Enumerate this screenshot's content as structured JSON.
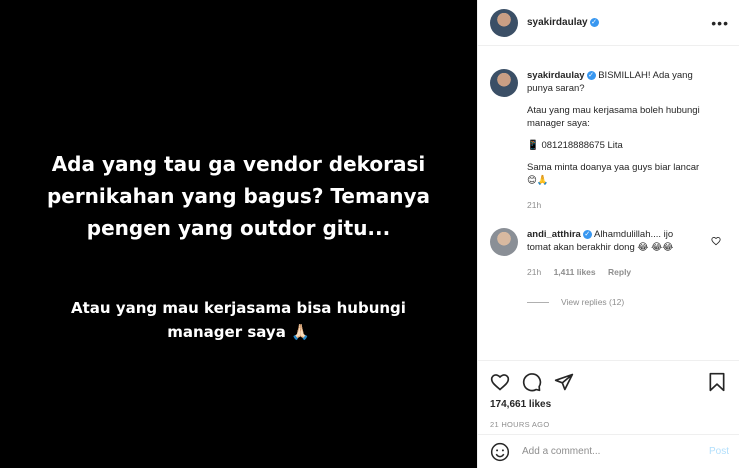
{
  "media": {
    "line1": "Ada yang tau ga vendor dekorasi pernikahan yang bagus? Temanya pengen yang outdor gitu...",
    "line2": "Atau yang mau kerjasama bisa hubungi manager saya 🙏🏻"
  },
  "header": {
    "username": "syakirdaulay",
    "more": "•••"
  },
  "caption": {
    "username": "syakirdaulay",
    "text1": "BISMILLAH! Ada yang punya saran?",
    "text2": "Atau yang mau kerjasama boleh hubungi manager saya:",
    "text3": "📱 081218888675 Lita",
    "text4": "Sama minta doanya yaa guys biar lancar 😊🙏",
    "time": "21h"
  },
  "comment": {
    "username": "andi_atthira",
    "text": "Alhamdulillah.... ijo tomat akan berakhir dong 😂 😂😂",
    "time": "21h",
    "likes": "1,411 likes",
    "reply": "Reply",
    "view_replies": "View replies (12)"
  },
  "footer": {
    "likes": "174,661 likes",
    "time": "21 HOURS AGO",
    "placeholder": "Add a comment...",
    "post": "Post"
  }
}
